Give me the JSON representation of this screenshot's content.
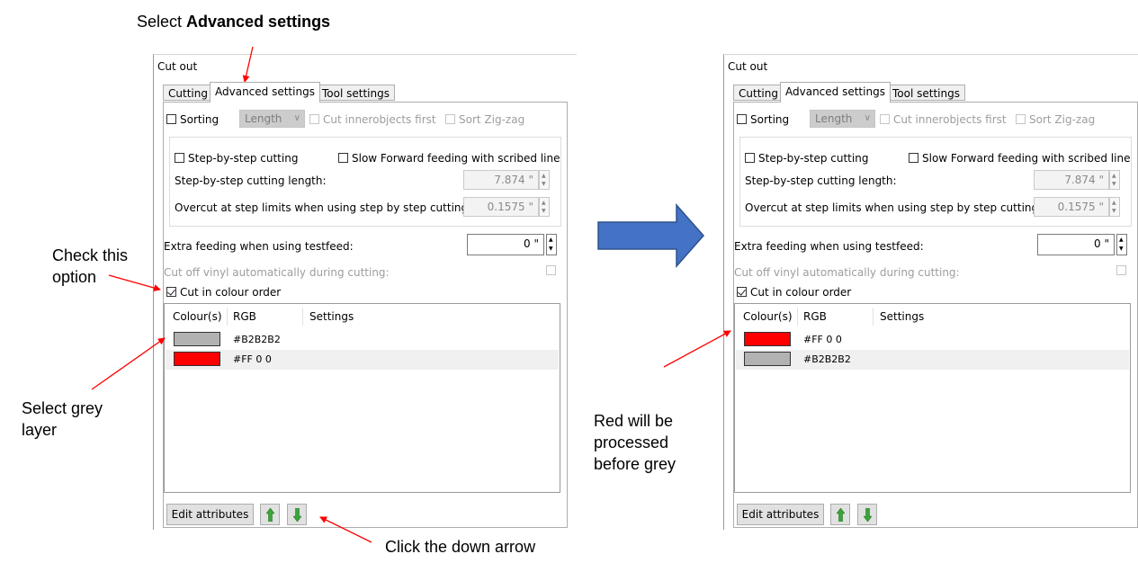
{
  "callouts": {
    "select_prefix": "Select ",
    "select_bold": "Advanced settings",
    "check_option": [
      "Check this",
      "option"
    ],
    "select_grey": [
      "Select grey",
      "layer"
    ],
    "red_processed": [
      "Red will be",
      "processed",
      "before grey"
    ],
    "click_down": "Click the down arrow"
  },
  "colors": {
    "accent_arrow": "#ff0000",
    "big_arrow": "#4472c4",
    "grey_swatch": "#b2b2b2",
    "red_swatch": "#ff0000"
  },
  "left": {
    "title": "Cut out",
    "tabs": [
      "Cutting",
      "Advanced settings",
      "Tool settings"
    ],
    "sorting": {
      "label": "Sorting",
      "combo": "Length",
      "inner": "Cut innerobjects first",
      "zigzag": "Sort Zig-zag"
    },
    "step": {
      "step_cut": "Step-by-step cutting",
      "slow_feed": "Slow Forward feeding with scribed line",
      "length_label": "Step-by-step cutting length:",
      "length_value": "7.874 \"",
      "overcut_label": "Overcut at step limits when using step by step cutting:",
      "overcut_value": "0.1575 \""
    },
    "extra_label": "Extra feeding when using testfeed:",
    "extra_value": "0 \"",
    "cutoff_label": "Cut off vinyl automatically during cutting:",
    "colour_order": "Cut in colour order",
    "columns": [
      "Colour(s)",
      "RGB",
      "Settings"
    ],
    "rows": [
      {
        "rgb": "#B2B2B2",
        "color": "#b2b2b2"
      },
      {
        "rgb": "#FF 0 0",
        "color": "#ff0000"
      }
    ],
    "edit_btn": "Edit attributes"
  },
  "right": {
    "title": "Cut out",
    "tabs": [
      "Cutting",
      "Advanced settings",
      "Tool settings"
    ],
    "sorting": {
      "label": "Sorting",
      "combo": "Length",
      "inner": "Cut innerobjects first",
      "zigzag": "Sort Zig-zag"
    },
    "step": {
      "step_cut": "Step-by-step cutting",
      "slow_feed": "Slow Forward feeding with scribed line",
      "length_label": "Step-by-step cutting length:",
      "length_value": "7.874 \"",
      "overcut_label": "Overcut at step limits when using step by step cutting:",
      "overcut_value": "0.1575 \""
    },
    "extra_label": "Extra feeding when using testfeed:",
    "extra_value": "0 \"",
    "cutoff_label": "Cut off vinyl automatically during cutting:",
    "colour_order": "Cut in colour order",
    "columns": [
      "Colour(s)",
      "RGB",
      "Settings"
    ],
    "rows": [
      {
        "rgb": "#FF 0 0",
        "color": "#ff0000"
      },
      {
        "rgb": "#B2B2B2",
        "color": "#b2b2b2"
      }
    ],
    "edit_btn": "Edit attributes"
  }
}
